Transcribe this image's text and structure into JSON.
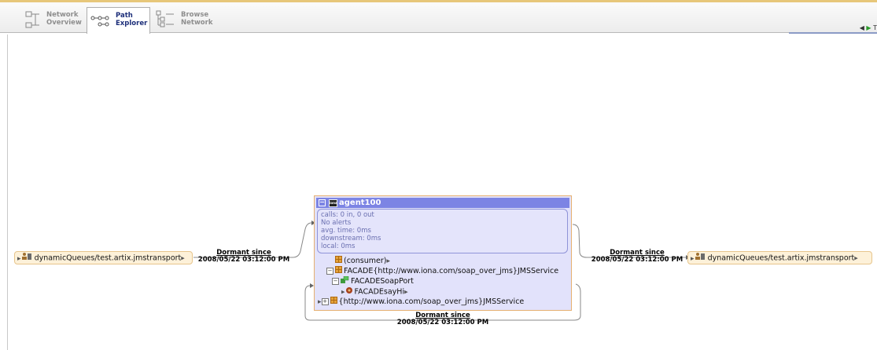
{
  "toolbar": {
    "tabs": [
      {
        "line1": "Network",
        "line2": "Overview",
        "active": false
      },
      {
        "line1": "Path",
        "line2": "Explorer",
        "active": true
      },
      {
        "line1": "Browse",
        "line2": "Network",
        "active": false
      }
    ],
    "right_partial_text": "T"
  },
  "endpoints": {
    "left": {
      "name": "dynamicQueues/test.artix.jmstransport"
    },
    "right": {
      "name": "dynamicQueues/test.artix.jmstransport"
    }
  },
  "links": {
    "left": {
      "title": "Dormant since",
      "date": "2008/05/22 03:12:00 PM"
    },
    "right": {
      "title": "Dormant since",
      "date": "2008/05/22 03:12:00 PM"
    },
    "bottom": {
      "title": "Dormant since",
      "date": "2008/05/22 03:12:00 PM"
    }
  },
  "agent": {
    "name": "agent100",
    "logo_text": "iona",
    "stats": {
      "calls": "calls: 0 in, 0 out",
      "alerts": "No alerts",
      "avg_time": "avg. time: 0ms",
      "downstream": "downstream: 0ms",
      "local": "local: 0ms"
    },
    "tree": {
      "consumer": "(consumer)",
      "facade": "FACADE{http://www.iona.com/soap_over_jms}JMSService",
      "port": "FACADESoapPort",
      "operation": "FACADEsayHi",
      "service": "{http://www.iona.com/soap_over_jms}JMSService"
    }
  },
  "colors": {
    "agent_header": "#7c84e4",
    "agent_body": "#e2e2fb",
    "endpoint_bg": "#fdf1d9",
    "active_tab_text": "#1d2f7a"
  }
}
